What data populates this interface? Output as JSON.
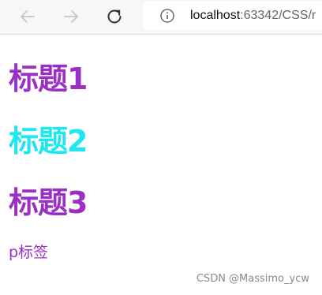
{
  "browser": {
    "url_host": "localhost",
    "url_port_path": ":63342/CSS/r",
    "back_icon": "arrow-left-icon",
    "forward_icon": "arrow-right-icon",
    "reload_icon": "reload-icon",
    "info_icon": "info-icon"
  },
  "page": {
    "heading1": "标题1",
    "heading2": "标题2",
    "heading3": "标题3",
    "paragraph": "p标签"
  },
  "colors": {
    "purple": "#9b30c4",
    "cyan": "#1ee8ef"
  },
  "watermark": "CSDN @Massimo_ycw"
}
